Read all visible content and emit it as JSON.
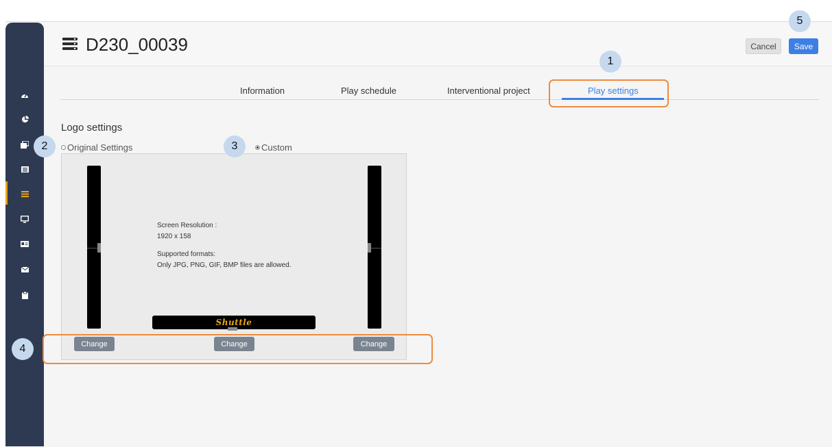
{
  "header": {
    "title": "D230_00039",
    "cancel_label": "Cancel",
    "save_label": "Save"
  },
  "sidebar": {
    "items": [
      {
        "icon": "dashboard-icon"
      },
      {
        "icon": "pie-chart-icon"
      },
      {
        "icon": "images-icon"
      },
      {
        "icon": "list-icon"
      },
      {
        "icon": "server-icon",
        "active": true
      },
      {
        "icon": "monitor-icon"
      },
      {
        "icon": "id-card-icon"
      },
      {
        "icon": "envelope-icon"
      },
      {
        "icon": "clipboard-icon"
      }
    ],
    "active_color": "#e8a317"
  },
  "tabs": [
    {
      "label": "Information"
    },
    {
      "label": "Play schedule"
    },
    {
      "label": "Interventional project"
    },
    {
      "label": "Play settings",
      "active": true
    }
  ],
  "logo": {
    "section_title": "Logo settings",
    "options": [
      {
        "label": "Original Settings",
        "selected": false
      },
      {
        "label": "Custom",
        "selected": true
      }
    ],
    "resolution_label": "Screen Resolution :",
    "resolution_value": "1920 x 158",
    "formats_label": "Supported formats:",
    "formats_value": "Only JPG, PNG, GIF, BMP files are allowed.",
    "preview_logo_text": "Shuttle",
    "change_buttons": [
      "Change",
      "Change",
      "Change"
    ]
  },
  "annotations": [
    "1",
    "2",
    "3",
    "4",
    "5"
  ],
  "colors": {
    "accent": "#3d7fe3",
    "highlight": "#ee8a3c",
    "callout": "#c5d8ee"
  }
}
